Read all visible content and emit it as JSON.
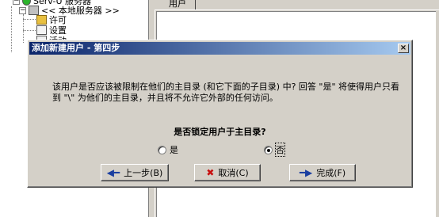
{
  "tree": {
    "root_label": "Serv-U 服务器",
    "server_label": "<< 本地服务器 >>",
    "items": [
      {
        "label": "许可"
      },
      {
        "label": "设置"
      },
      {
        "label": "活动"
      }
    ]
  },
  "right_pane": {
    "tab_label": "用户"
  },
  "dialog": {
    "title": "添加新建用户 - 第四步",
    "close_glyph": "×",
    "description": "该用户是否应该被限制在他们的主目录 (和它下面的子目录) 中? 回答 \"是\" 将使得用户只看到 \"\\\" 为他们的主目录，并且将不允许它外部的任何访问。",
    "question": "是否锁定用户于主目录?",
    "options": [
      {
        "label": "是",
        "selected": false
      },
      {
        "label": "否",
        "selected": true
      }
    ],
    "buttons": {
      "back": "上一步(B)",
      "cancel": "取消(C)",
      "finish": "完成(F)"
    },
    "icons": {
      "back": "left-arrow-icon",
      "cancel": "red-x-icon",
      "finish": "right-arrow-icon"
    },
    "colors": {
      "title_start": "#0a246a",
      "title_end": "#a6caf0",
      "face": "#d4d0c8"
    }
  }
}
